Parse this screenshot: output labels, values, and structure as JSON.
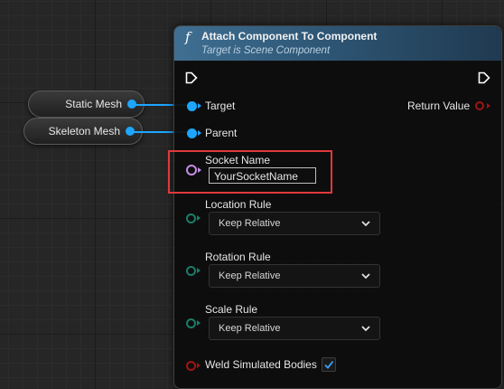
{
  "variables": {
    "static_mesh": "Static Mesh",
    "skeleton_mesh": "Skeleton Mesh"
  },
  "node": {
    "func_icon": "f",
    "title": "Attach Component To Component",
    "subtitle": "Target is Scene Component",
    "target_label": "Target",
    "parent_label": "Parent",
    "return_label": "Return Value",
    "socket_label": "Socket Name",
    "socket_value": "YourSocketName",
    "location_rule_label": "Location Rule",
    "location_rule_value": "Keep Relative",
    "rotation_rule_label": "Rotation Rule",
    "rotation_rule_value": "Keep Relative",
    "scale_rule_label": "Scale Rule",
    "scale_rule_value": "Keep Relative",
    "weld_label": "Weld Simulated Bodies",
    "weld_checked": true
  },
  "colors": {
    "object_pin": "#1ea6ff",
    "name_pin": "#c48ee6",
    "enum_pin": "#1a7d69",
    "bool_pin": "#9e1414",
    "highlight": "#e0393b",
    "header": "#3f6f92"
  },
  "icons": {
    "chevron": "chevron-down-icon",
    "check": "checkmark-icon",
    "function": "function-icon"
  }
}
